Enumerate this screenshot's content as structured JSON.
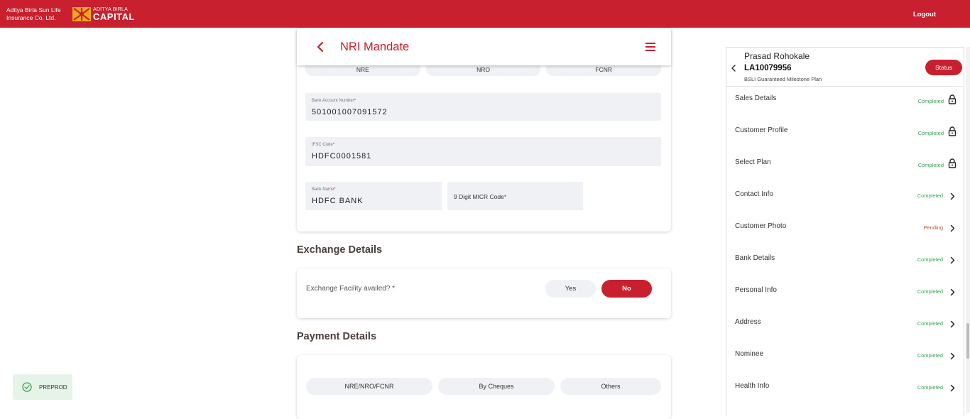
{
  "header": {
    "brand1_line1": "Aditya Birla Sun Life",
    "brand1_line2": "Insurance Co. Ltd.",
    "brand2_small": "ADITYA BIRLA",
    "brand2_big": "CAPITAL",
    "logout_label": "Logout",
    "accent_color": "#c8202f"
  },
  "nri": {
    "title": "NRI Mandate",
    "account_types": [
      "NRE",
      "NRO",
      "FCNR"
    ],
    "bank_account": {
      "label": "Bank Account Number",
      "value": "501001007091572"
    },
    "ifsc": {
      "label": "IFSC Code",
      "value": "HDFC0001581"
    },
    "bank_name": {
      "label": "Bank Name",
      "value": "HDFC BANK"
    },
    "micr": {
      "placeholder": "9 Digit MICR Code"
    },
    "required_marker": "*"
  },
  "exchange": {
    "section_title": "Exchange Details",
    "question": "Exchange Facility availed? *",
    "yes_label": "Yes",
    "no_label": "No",
    "selected": "No"
  },
  "payment": {
    "section_title": "Payment Details",
    "options": [
      "NRE/NRO/FCNR",
      "By Cheques",
      "Others"
    ]
  },
  "env_badge": "PREPROD",
  "side": {
    "name": "Prasad Rohokale",
    "application_id": "LA10079956",
    "plan": "BSLI Guaranteed Milestone Plan",
    "status_label": "Status",
    "items": [
      {
        "label": "Sales Details",
        "status": "Completed",
        "icon": "lock-icon"
      },
      {
        "label": "Customer Profile",
        "status": "Completed",
        "icon": "lock-icon"
      },
      {
        "label": "Select Plan",
        "status": "Completed",
        "icon": "lock-icon"
      },
      {
        "label": "Contact Info",
        "status": "Completed",
        "icon": "chevron-right-icon"
      },
      {
        "label": "Customer Photo",
        "status": "Pending",
        "icon": "chevron-right-icon"
      },
      {
        "label": "Bank Details",
        "status": "Completed",
        "icon": "chevron-right-icon"
      },
      {
        "label": "Personal Info",
        "status": "Completed",
        "icon": "chevron-right-icon"
      },
      {
        "label": "Address",
        "status": "Completed",
        "icon": "chevron-right-icon"
      },
      {
        "label": "Nominee",
        "status": "Completed",
        "icon": "chevron-right-icon"
      },
      {
        "label": "Health Info",
        "status": "Completed",
        "icon": "chevron-right-icon"
      }
    ]
  }
}
